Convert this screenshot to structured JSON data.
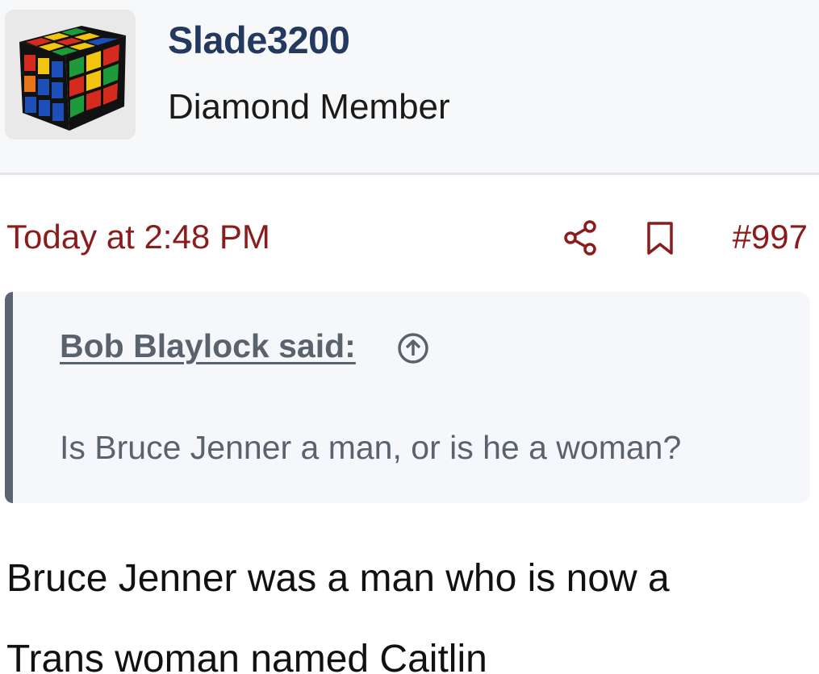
{
  "user": {
    "username": "Slade3200",
    "title": "Diamond Member"
  },
  "post": {
    "timestamp": "Today at 2:48 PM",
    "number": "#997",
    "icons": {
      "share": "share-icon",
      "bookmark": "bookmark-icon"
    }
  },
  "quote": {
    "author_label": "Bob Blaylock said:",
    "icon": "arrow-up-circle-icon",
    "text": "Is Bruce Jenner a man, or is he a woman?"
  },
  "reply": {
    "line1": "Bruce Jenner was a man who is now a",
    "line2": "Trans woman named Caitlin"
  },
  "colors": {
    "username": "#233a5e",
    "meta_accent": "#8a1c1c",
    "quote_text": "#5a636d",
    "quote_border": "#5b6470",
    "header_bg": "#f7f8fa"
  }
}
